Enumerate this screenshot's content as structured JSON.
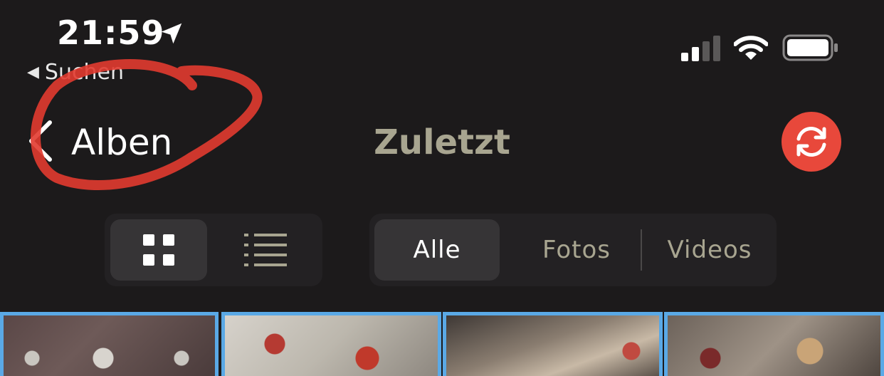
{
  "status_bar": {
    "time": "21:59",
    "back_app_label": "Suchen",
    "back_app_arrow": "◀",
    "icons": [
      "location-arrow-icon",
      "cellular-signal-icon",
      "wifi-icon",
      "battery-icon"
    ]
  },
  "nav": {
    "back_label": "Alben",
    "title": "Zuletzt",
    "sync_icon": "sync-icon"
  },
  "view_toggle": {
    "options": [
      "grid-icon",
      "list-icon"
    ],
    "selected": "grid-icon"
  },
  "filter": {
    "options": [
      "Alle",
      "Fotos",
      "Videos"
    ],
    "selected": "Alle"
  },
  "colors": {
    "background": "#1c1a1b",
    "title": "#a8a590",
    "accent_red": "#e8483b",
    "selection_border": "#5aa9e6",
    "segment_bg": "#232123",
    "segment_selected": "#363436"
  },
  "photo_grid": {
    "tiles": [
      "photo-thumbnail",
      "photo-thumbnail",
      "photo-thumbnail",
      "photo-thumbnail"
    ]
  }
}
